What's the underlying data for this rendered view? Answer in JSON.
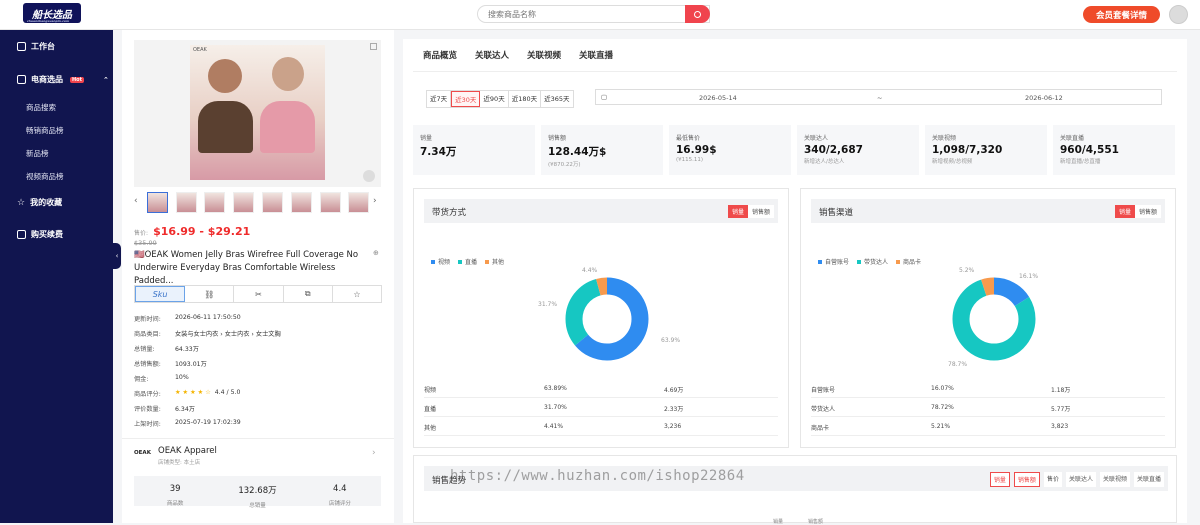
{
  "header": {
    "logo_text": "船长选品",
    "logo_sub": "chuanzhangxuanpin.com",
    "search_placeholder": "搜索商品名称",
    "vip_label": "会员套餐详情"
  },
  "sidebar": {
    "workbench": "工作台",
    "ecom": "电商选品",
    "hot": "Hot",
    "sub_items": [
      "商品搜索",
      "畅销商品榜",
      "新品榜",
      "视频商品榜"
    ],
    "favorites": "我的收藏",
    "purchase": "购买续费"
  },
  "product": {
    "image_brand": "OEAK",
    "price_label": "售价:",
    "price": "$16.99 - $29.21",
    "old_price": "$35.99",
    "title": "🇺🇸OEAK Women Jelly Bras Wirefree Full Coverage No Underwire Everyday Bras Comfortable Wireless Padded...",
    "tab_sku": "Sku",
    "info": [
      {
        "k": "更新时间:",
        "v": "2026-06-11 17:50:50"
      },
      {
        "k": "商品类目:",
        "v": "女装与女士内衣 › 女士内衣 › 女士文胸"
      },
      {
        "k": "总销量:",
        "v": "64.33万"
      },
      {
        "k": "总销售额:",
        "v": "1093.01万"
      },
      {
        "k": "佣金:",
        "v": "10%"
      },
      {
        "k": "商品评分:",
        "v": "4.4 / 5.0"
      },
      {
        "k": "评价数量:",
        "v": "6.34万"
      },
      {
        "k": "上架时间:",
        "v": "2025-07-19 17:02:39"
      }
    ],
    "rating": 4.4
  },
  "shop": {
    "logo": "OEAK",
    "name": "OEAK Apparel",
    "type": "店铺类型: 本土店",
    "stats": [
      {
        "n": "39",
        "l": "商品数"
      },
      {
        "n": "132.68万",
        "l": "总销量"
      },
      {
        "n": "4.4",
        "l": "店铺评分"
      }
    ]
  },
  "tabs": [
    "商品概览",
    "关联达人",
    "关联视频",
    "关联直播"
  ],
  "days": [
    "近7天",
    "近30天",
    "近90天",
    "近180天",
    "近365天"
  ],
  "date_from": "2026-05-14",
  "date_sep": "~",
  "date_to": "2026-06-12",
  "cards": [
    {
      "t": "销量",
      "n": "7.34万",
      "s": ""
    },
    {
      "t": "销售额",
      "n": "128.44万$",
      "s": "(¥870.22万)"
    },
    {
      "t": "最低售价",
      "n": "16.99$",
      "s": "(¥115.11)"
    },
    {
      "t": "关联达人",
      "n": "340/2,687",
      "s": "新增达人/总达人"
    },
    {
      "t": "关联视频",
      "n": "1,098/7,320",
      "s": "新增视频/总视频"
    },
    {
      "t": "关联直播",
      "n": "960/4,551",
      "s": "新增直播/总直播"
    }
  ],
  "panel1": {
    "title": "带货方式",
    "toggle": [
      "销量",
      "销售额"
    ],
    "legend": [
      "视频",
      "直播",
      "其他"
    ],
    "colors": [
      "#2f8cf0",
      "#16c7c2",
      "#f79a4d"
    ],
    "slices": [
      63.89,
      31.7,
      4.41
    ],
    "labels": [
      "63.9%",
      "31.7%",
      "4.4%"
    ],
    "rows": [
      {
        "a": "视频",
        "b": "63.89%",
        "c": "4.69万"
      },
      {
        "a": "直播",
        "b": "31.70%",
        "c": "2.33万"
      },
      {
        "a": "其他",
        "b": "4.41%",
        "c": "3,236"
      }
    ]
  },
  "panel2": {
    "title": "销售渠道",
    "toggle": [
      "销量",
      "销售额"
    ],
    "legend": [
      "自营账号",
      "带货达人",
      "商品卡"
    ],
    "colors": [
      "#2f8cf0",
      "#16c7c2",
      "#f79a4d"
    ],
    "slices": [
      16.07,
      78.72,
      5.21
    ],
    "labels": [
      "16.1%",
      "78.7%",
      "5.2%"
    ],
    "rows": [
      {
        "a": "自营账号",
        "b": "16.07%",
        "c": "1.18万"
      },
      {
        "a": "带货达人",
        "b": "78.72%",
        "c": "5.77万"
      },
      {
        "a": "商品卡",
        "b": "5.21%",
        "c": "3,823"
      }
    ]
  },
  "trend": {
    "title": "销售趋势",
    "toggle": [
      "销量",
      "销售额",
      "售价",
      "关联达人",
      "关联视频",
      "关联直播"
    ],
    "bottom": [
      "销量",
      "销售额"
    ]
  },
  "watermark": "https://www.huzhan.com/ishop22864"
}
